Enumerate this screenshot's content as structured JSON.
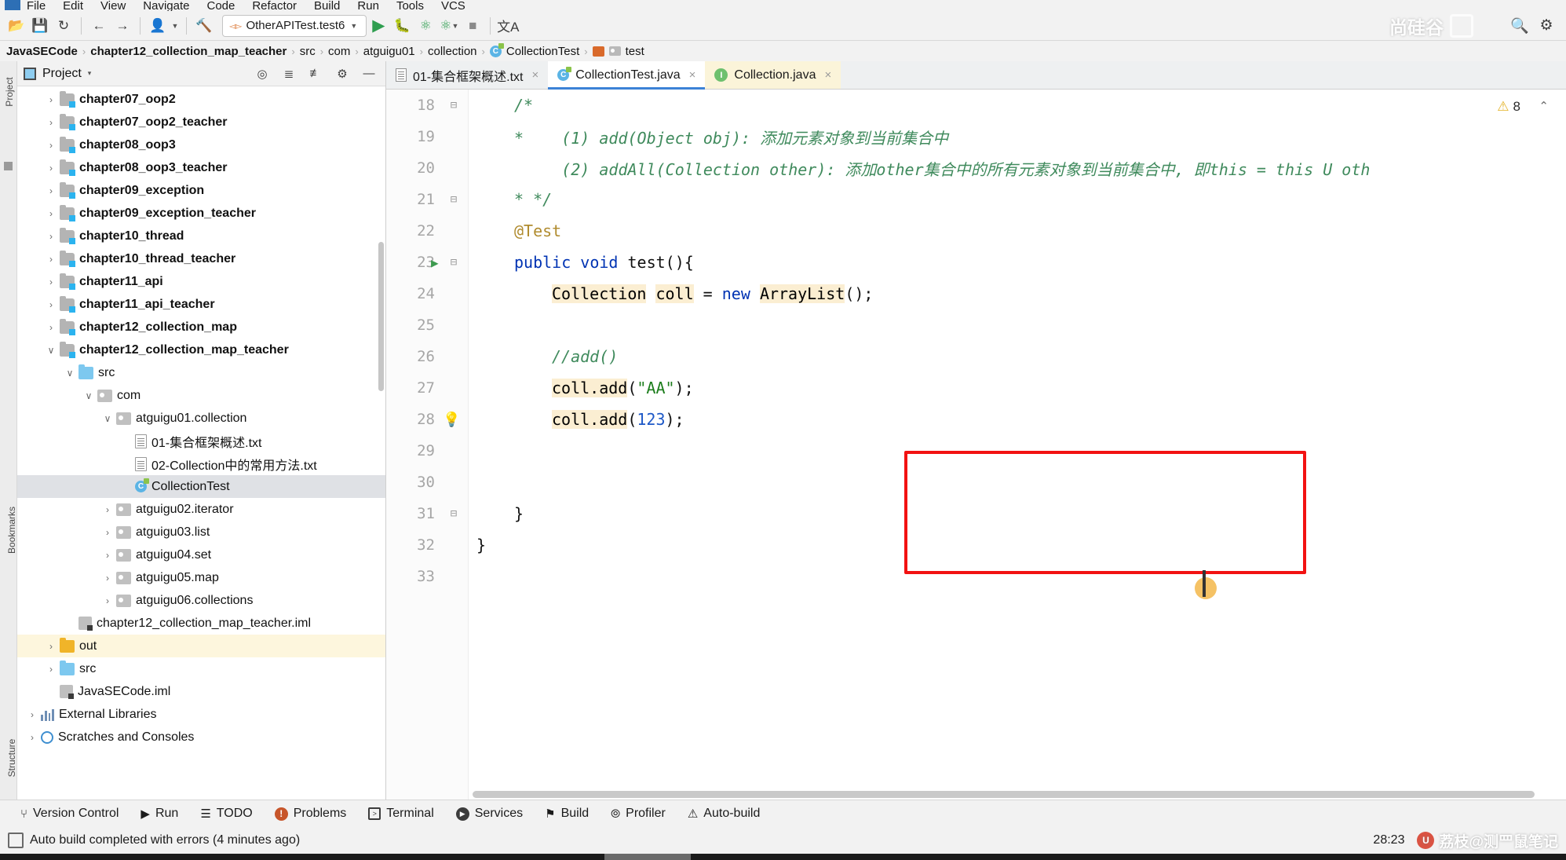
{
  "menubar": {
    "items": [
      "File",
      "Edit",
      "View",
      "Navigate",
      "Code",
      "Refactor",
      "Build",
      "Run",
      "Tools",
      "VCS"
    ]
  },
  "toolbar": {
    "icons": [
      "open-folder-icon",
      "save-icon",
      "sync-icon",
      "back-arrow-icon",
      "forward-arrow-icon",
      "profile-icon",
      "hammer-icon"
    ],
    "run_config": "OtherAPITest.test6",
    "run_label": "run-button",
    "debug_label": "debug-button",
    "coverage_label": "run-with-coverage-button",
    "more_run_label": "more-run-options-button",
    "stop_label": "stop-button",
    "translate_label": "translate-button",
    "search_label": "search-everywhere-button",
    "settings_label": "settings-button",
    "watermark": "尚硅谷"
  },
  "breadcrumb": {
    "items": [
      {
        "label": "JavaSECode",
        "icon": "",
        "bold": true
      },
      {
        "label": "chapter12_collection_map_teacher",
        "icon": "",
        "bold": true
      },
      {
        "label": "src",
        "icon": "",
        "bold": false
      },
      {
        "label": "com",
        "icon": "",
        "bold": false
      },
      {
        "label": "atguigu01",
        "icon": "",
        "bold": false
      },
      {
        "label": "collection",
        "icon": "",
        "bold": false
      },
      {
        "label": "CollectionTest",
        "icon": "class-icon",
        "bold": false
      },
      {
        "label": "test",
        "icon": "module-icon",
        "bold": false
      }
    ],
    "separator": "›"
  },
  "project_panel": {
    "title": "Project",
    "dropdown_caret": "▾",
    "header_icons": [
      "locate-icon",
      "expand-all-icon",
      "collapse-all-icon",
      "settings-gear-icon",
      "hide-icon"
    ],
    "vertical_labels": {
      "project": "Project",
      "bookmarks": "Bookmarks",
      "structure": "Structure"
    },
    "tree": [
      {
        "label": "chapter07_oop2",
        "indent": 1,
        "arrow": "›",
        "icon": "module-folder-icon",
        "bold": true,
        "state": ""
      },
      {
        "label": "chapter07_oop2_teacher",
        "indent": 1,
        "arrow": "›",
        "icon": "module-folder-icon",
        "bold": true,
        "state": ""
      },
      {
        "label": "chapter08_oop3",
        "indent": 1,
        "arrow": "›",
        "icon": "module-folder-icon",
        "bold": true,
        "state": ""
      },
      {
        "label": "chapter08_oop3_teacher",
        "indent": 1,
        "arrow": "›",
        "icon": "module-folder-icon",
        "bold": true,
        "state": ""
      },
      {
        "label": "chapter09_exception",
        "indent": 1,
        "arrow": "›",
        "icon": "module-folder-icon",
        "bold": true,
        "state": ""
      },
      {
        "label": "chapter09_exception_teacher",
        "indent": 1,
        "arrow": "›",
        "icon": "module-folder-icon",
        "bold": true,
        "state": ""
      },
      {
        "label": "chapter10_thread",
        "indent": 1,
        "arrow": "›",
        "icon": "module-folder-icon",
        "bold": true,
        "state": ""
      },
      {
        "label": "chapter10_thread_teacher",
        "indent": 1,
        "arrow": "›",
        "icon": "module-folder-icon",
        "bold": true,
        "state": ""
      },
      {
        "label": "chapter11_api",
        "indent": 1,
        "arrow": "›",
        "icon": "module-folder-icon",
        "bold": true,
        "state": ""
      },
      {
        "label": "chapter11_api_teacher",
        "indent": 1,
        "arrow": "›",
        "icon": "module-folder-icon",
        "bold": true,
        "state": ""
      },
      {
        "label": "chapter12_collection_map",
        "indent": 1,
        "arrow": "›",
        "icon": "module-folder-icon",
        "bold": true,
        "state": ""
      },
      {
        "label": "chapter12_collection_map_teacher",
        "indent": 1,
        "arrow": "∨",
        "icon": "module-folder-icon",
        "bold": true,
        "state": ""
      },
      {
        "label": "src",
        "indent": 2,
        "arrow": "∨",
        "icon": "source-folder-icon",
        "bold": false,
        "state": ""
      },
      {
        "label": "com",
        "indent": 3,
        "arrow": "∨",
        "icon": "package-icon",
        "bold": false,
        "state": ""
      },
      {
        "label": "atguigu01.collection",
        "indent": 4,
        "arrow": "∨",
        "icon": "package-icon",
        "bold": false,
        "state": ""
      },
      {
        "label": "01-集合框架概述.txt",
        "indent": 5,
        "arrow": "",
        "icon": "text-file-icon",
        "bold": false,
        "state": ""
      },
      {
        "label": "02-Collection中的常用方法.txt",
        "indent": 5,
        "arrow": "",
        "icon": "text-file-icon",
        "bold": false,
        "state": ""
      },
      {
        "label": "CollectionTest",
        "indent": 5,
        "arrow": "",
        "icon": "java-class-icon",
        "bold": false,
        "state": "selected"
      },
      {
        "label": "atguigu02.iterator",
        "indent": 4,
        "arrow": "›",
        "icon": "package-icon",
        "bold": false,
        "state": ""
      },
      {
        "label": "atguigu03.list",
        "indent": 4,
        "arrow": "›",
        "icon": "package-icon",
        "bold": false,
        "state": ""
      },
      {
        "label": "atguigu04.set",
        "indent": 4,
        "arrow": "›",
        "icon": "package-icon",
        "bold": false,
        "state": ""
      },
      {
        "label": "atguigu05.map",
        "indent": 4,
        "arrow": "›",
        "icon": "package-icon",
        "bold": false,
        "state": ""
      },
      {
        "label": "atguigu06.collections",
        "indent": 4,
        "arrow": "›",
        "icon": "package-icon",
        "bold": false,
        "state": ""
      },
      {
        "label": "chapter12_collection_map_teacher.iml",
        "indent": 2,
        "arrow": "",
        "icon": "iml-file-icon",
        "bold": false,
        "state": ""
      },
      {
        "label": "out",
        "indent": 1,
        "arrow": "›",
        "icon": "out-folder-icon",
        "bold": false,
        "state": "highlighted"
      },
      {
        "label": "src",
        "indent": 1,
        "arrow": "›",
        "icon": "source-folder-icon",
        "bold": false,
        "state": ""
      },
      {
        "label": "JavaSECode.iml",
        "indent": 1,
        "arrow": "",
        "icon": "iml-file-icon",
        "bold": false,
        "state": ""
      },
      {
        "label": "External Libraries",
        "indent": 0,
        "arrow": "›",
        "icon": "libraries-icon",
        "bold": false,
        "state": ""
      },
      {
        "label": "Scratches and Consoles",
        "indent": 0,
        "arrow": "›",
        "icon": "scratches-icon",
        "bold": false,
        "state": ""
      }
    ]
  },
  "editor_tabs": [
    {
      "label": "01-集合框架概述.txt",
      "icon": "text-file-icon",
      "active": false,
      "style": "plain"
    },
    {
      "label": "CollectionTest.java",
      "icon": "java-class-icon",
      "active": true,
      "style": "plain"
    },
    {
      "label": "Collection.java",
      "icon": "java-interface-icon",
      "active": false,
      "style": "modified"
    }
  ],
  "editor": {
    "warning_count": "8",
    "warning_icon": "warning-triangle-icon",
    "chevron": "⌃",
    "lines": [
      {
        "num": "18",
        "fold": "─",
        "run": false,
        "bulb": false,
        "tokens": [
          {
            "t": "/*",
            "c": "cmt",
            "indent": 0
          }
        ]
      },
      {
        "num": "19",
        "fold": "",
        "run": false,
        "bulb": false,
        "tokens": [
          {
            "t": "*    (1) add(Object obj): 添加元素对象到当前集合中",
            "c": "cmt",
            "indent": 0
          }
        ]
      },
      {
        "num": "20",
        "fold": "",
        "run": false,
        "bulb": false,
        "tokens": [
          {
            "t": "     (2) addAll(Collection other): 添加other集合中的所有元素对象到当前集合中, 即this = this U oth",
            "c": "cmt",
            "indent": 0
          }
        ]
      },
      {
        "num": "21",
        "fold": "─",
        "run": false,
        "bulb": false,
        "tokens": [
          {
            "t": "* */",
            "c": "cmt",
            "indent": 0
          }
        ]
      },
      {
        "num": "22",
        "fold": "",
        "run": false,
        "bulb": false,
        "tokens": [
          {
            "t": "@Test",
            "c": "ann",
            "indent": 0
          }
        ]
      },
      {
        "num": "23",
        "fold": "─",
        "run": true,
        "bulb": false,
        "tokens": [
          {
            "t": "public void ",
            "c": "kw",
            "indent": 0
          },
          {
            "t": "test(){",
            "c": "plain",
            "indent": 0
          }
        ]
      },
      {
        "num": "24",
        "fold": "",
        "run": false,
        "bulb": false,
        "tokens": [
          {
            "t": "Collection",
            "c": "hl",
            "indent": 1
          },
          {
            "t": " ",
            "c": "plain",
            "indent": 0
          },
          {
            "t": "coll",
            "c": "hl",
            "indent": 0
          },
          {
            "t": " = ",
            "c": "plain",
            "indent": 0
          },
          {
            "t": "new",
            "c": "kw",
            "indent": 0
          },
          {
            "t": " ",
            "c": "plain",
            "indent": 0
          },
          {
            "t": "ArrayList",
            "c": "hl",
            "indent": 0
          },
          {
            "t": "();",
            "c": "plain",
            "indent": 0
          }
        ]
      },
      {
        "num": "25",
        "fold": "",
        "run": false,
        "bulb": false,
        "tokens": []
      },
      {
        "num": "26",
        "fold": "",
        "run": false,
        "bulb": false,
        "tokens": [
          {
            "t": "//add()",
            "c": "cmt",
            "indent": 1
          }
        ]
      },
      {
        "num": "27",
        "fold": "",
        "run": false,
        "bulb": false,
        "tokens": [
          {
            "t": "coll.add",
            "c": "hl",
            "indent": 1
          },
          {
            "t": "(",
            "c": "plain",
            "indent": 0
          },
          {
            "t": "\"AA\"",
            "c": "str",
            "indent": 0
          },
          {
            "t": ");",
            "c": "plain",
            "indent": 0
          }
        ]
      },
      {
        "num": "28",
        "fold": "",
        "run": false,
        "bulb": true,
        "tokens": [
          {
            "t": "coll.add",
            "c": "hl",
            "indent": 1
          },
          {
            "t": "(",
            "c": "plain",
            "indent": 0
          },
          {
            "t": "123",
            "c": "num",
            "indent": 0
          },
          {
            "t": ");",
            "c": "plain",
            "indent": 0
          }
        ]
      },
      {
        "num": "29",
        "fold": "",
        "run": false,
        "bulb": false,
        "tokens": []
      },
      {
        "num": "30",
        "fold": "",
        "run": false,
        "bulb": false,
        "tokens": []
      },
      {
        "num": "31",
        "fold": "─",
        "run": false,
        "bulb": false,
        "tokens": [
          {
            "t": "}",
            "c": "plain",
            "indent": 0
          }
        ]
      },
      {
        "num": "32",
        "fold": "",
        "run": false,
        "bulb": false,
        "tokens": [
          {
            "t": "}",
            "c": "plain",
            "indent": -1
          }
        ]
      },
      {
        "num": "33",
        "fold": "",
        "run": false,
        "bulb": false,
        "tokens": []
      }
    ]
  },
  "tool_windows": [
    {
      "label": "Version Control",
      "icon": "branch-icon"
    },
    {
      "label": "Run",
      "icon": "play-icon"
    },
    {
      "label": "TODO",
      "icon": "list-icon"
    },
    {
      "label": "Problems",
      "icon": "problems-icon"
    },
    {
      "label": "Terminal",
      "icon": "terminal-icon"
    },
    {
      "label": "Services",
      "icon": "services-icon"
    },
    {
      "label": "Build",
      "icon": "hammer-icon"
    },
    {
      "label": "Profiler",
      "icon": "profiler-icon"
    },
    {
      "label": "Auto-build",
      "icon": "warning-triangle-icon"
    }
  ],
  "status_bar": {
    "message": "Auto build completed with errors (4 minutes ago)",
    "caret_position": "28:23",
    "watermark": "荔枝@测罒鼠笔记"
  }
}
